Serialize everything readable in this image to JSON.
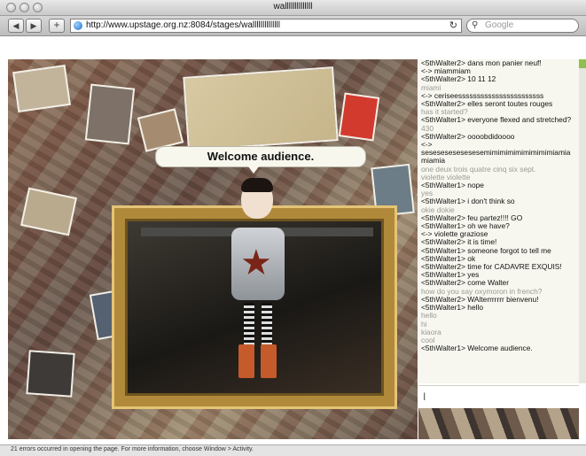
{
  "window": {
    "title": "wallllllllllllll"
  },
  "toolbar": {
    "back_icon": "back-arrow",
    "forward_icon": "forward-arrow",
    "add_icon": "plus",
    "url": "http://www.upstage.org.nz:8084/stages/wallllllllllllll",
    "search_placeholder": "Google"
  },
  "stage": {
    "speech_bubble": "Welcome audience."
  },
  "chat": {
    "lines": [
      {
        "text": "<5thWalter2> dans mon panier neuf!",
        "style": "black"
      },
      {
        "text": "<-> miammiam",
        "style": "black"
      },
      {
        "text": "<5thWalter2> 10 11 12",
        "style": "black"
      },
      {
        "text": "miami",
        "style": "gray"
      },
      {
        "text": "<-> ceriseesssssssssssssssssssssss",
        "style": "black"
      },
      {
        "text": "<5thWalter2> elles seront toutes rouges",
        "style": "black"
      },
      {
        "text": "has it started?",
        "style": "gray"
      },
      {
        "text": "<5thWalter1> everyone flexed and stretched?",
        "style": "black"
      },
      {
        "text": "430",
        "style": "gray"
      },
      {
        "text": "<5thWalter2> oooobdidoooo",
        "style": "black"
      },
      {
        "text": "<-> sesesesesesesesemimimimimimimimimiamiamiamia",
        "style": "black"
      },
      {
        "text": "one deux trois quatre cinq six sept.",
        "style": "gray"
      },
      {
        "text": "violette violette",
        "style": "gray"
      },
      {
        "text": "<5thWalter1> nope",
        "style": "black"
      },
      {
        "text": "yes",
        "style": "gray"
      },
      {
        "text": "<5thWalter1> i don't think so",
        "style": "black"
      },
      {
        "text": "okie dokie",
        "style": "gray"
      },
      {
        "text": "<5thWalter2> feu partez!!!! GO",
        "style": "black"
      },
      {
        "text": "<5thWalter1> oh we have?",
        "style": "black"
      },
      {
        "text": "<-> violette graziose",
        "style": "black"
      },
      {
        "text": "<5thWalter2> it is time!",
        "style": "black"
      },
      {
        "text": "<5thWalter1> someone forgot to tell me",
        "style": "black"
      },
      {
        "text": "<5thWalter1> ok",
        "style": "black"
      },
      {
        "text": "<5thWalter2> time for CADAVRE EXQUIS!",
        "style": "black"
      },
      {
        "text": "<5thWalter1> yes",
        "style": "black"
      },
      {
        "text": "<5thWalter2> come Walter",
        "style": "black"
      },
      {
        "text": "how do you say oxymoron in french?",
        "style": "gray"
      },
      {
        "text": "<5thWalter2> WAlterrrrrrr bienvenu!",
        "style": "black"
      },
      {
        "text": "<5thWalter1> hello",
        "style": "black"
      },
      {
        "text": "hello",
        "style": "gray"
      },
      {
        "text": "hi",
        "style": "gray"
      },
      {
        "text": "kiaora",
        "style": "gray"
      },
      {
        "text": "cool",
        "style": "gray"
      },
      {
        "text": "<5thWalter1> Welcome audience.",
        "style": "black"
      }
    ],
    "input_value": ""
  },
  "status": {
    "text": "21 errors occurred in opening the page. For more information, choose Window > Activity."
  },
  "colors": {
    "chat_bg": "#f7f7ef",
    "chat_gray": "#9a9a96",
    "frame_gold": "#b08a3a"
  }
}
